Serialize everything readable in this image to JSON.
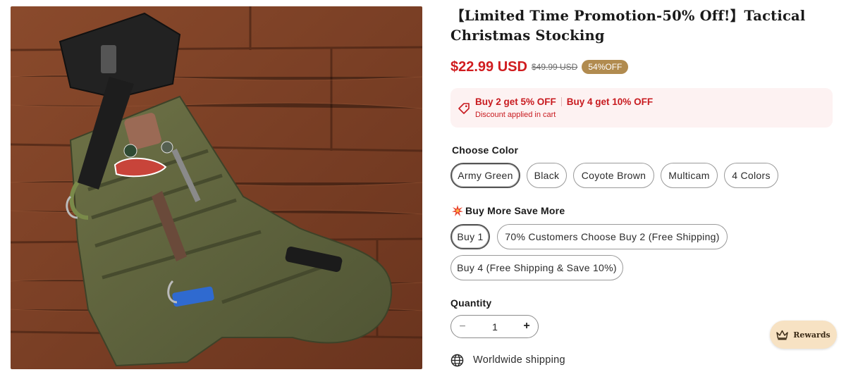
{
  "product": {
    "title": "【Limited Time Promotion-50% Off!】Tactical Christmas Stocking",
    "image_alt": "Army green tactical Christmas stocking with axe and gear on wooden floor"
  },
  "price": {
    "sale": "$22.99 USD",
    "compare": "$49.99 USD",
    "badge": "54%OFF"
  },
  "discount": {
    "offer_1": "Buy 2 get 5% OFF",
    "offer_2": "Buy 4 get 10% OFF",
    "note": "Discount applied in cart"
  },
  "color": {
    "label": "Choose Color",
    "options": [
      "Army Green",
      "Black",
      "Coyote Brown",
      "Multicam",
      "4 Colors"
    ],
    "selected": "Army Green"
  },
  "bundle": {
    "label": "Buy More Save More",
    "options": [
      "Buy 1",
      "70% Customers Choose Buy 2 (Free Shipping)",
      "Buy 4 (Free Shipping & Save 10%)"
    ],
    "selected": "Buy 1"
  },
  "quantity": {
    "label": "Quantity",
    "value": "1",
    "minus": "−",
    "plus": "+"
  },
  "shipping": {
    "text": "Worldwide shipping"
  },
  "rewards": {
    "label": "Rewards"
  },
  "colors": {
    "sale_red": "#d01c1f",
    "badge_gold": "#b18b4f",
    "discount_bg": "#fdf2f2",
    "rewards_bg": "#f7e2c3"
  },
  "icons": [
    "tag-icon",
    "sparkle-icon",
    "minus-icon",
    "plus-icon",
    "globe-icon",
    "crown-icon"
  ]
}
